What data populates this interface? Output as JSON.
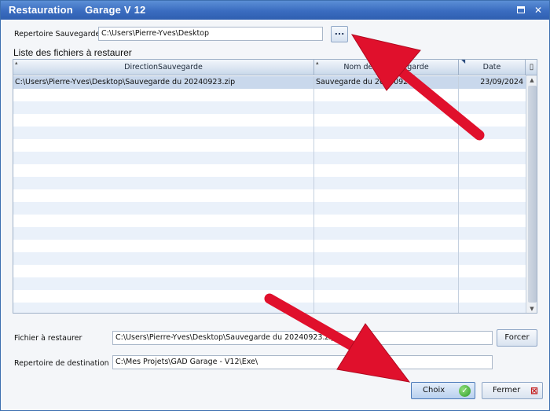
{
  "window": {
    "title": "Restauration    Garage V 12",
    "maximize_icon": "maximize-icon",
    "close_glyph": "✕"
  },
  "source_folder": {
    "label": "Repertoire Sauvegarde",
    "value": "C:\\Users\\Pierre-Yves\\Desktop",
    "browse_label": "..."
  },
  "file_list": {
    "title": "Liste des fichiers à restaurer",
    "columns": [
      {
        "label": "DirectionSauvegarde"
      },
      {
        "label": "Nom de la Sauvegarde"
      },
      {
        "label": "Date"
      }
    ],
    "rows": [
      {
        "path": "C:\\Users\\Pierre-Yves\\Desktop\\Sauvegarde du 20240923.zip",
        "name": "Sauvegarde du 20240923",
        "date": "23/09/2024"
      }
    ]
  },
  "restore_file": {
    "label": "Fichier à restaurer",
    "value": "C:\\Users\\Pierre-Yves\\Desktop\\Sauvegarde du 20240923.zip",
    "force_label": "Forcer"
  },
  "destination": {
    "label": "Repertoire de destination",
    "value": "C:\\Mes Projets\\GAD Garage - V12\\Exe\\"
  },
  "actions": {
    "choose_label": "Choix",
    "close_label": "Fermer"
  },
  "colors": {
    "titlebar": "#3a6cc0",
    "annotation_arrow": "#e0102c"
  }
}
